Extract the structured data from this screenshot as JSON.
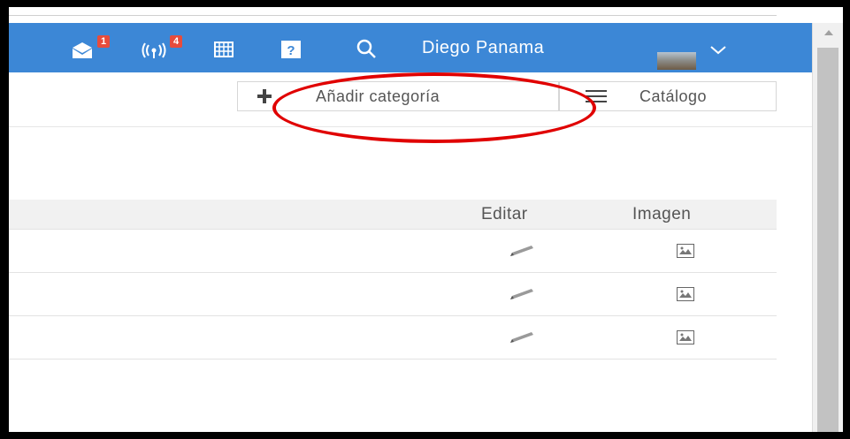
{
  "header": {
    "mail_badge": "1",
    "signal_badge": "4",
    "user_name": "Diego Panama",
    "icons": [
      "mail-icon",
      "signal-icon",
      "grid-icon",
      "help-icon",
      "search-icon",
      "chevron-down-icon"
    ],
    "bar_color": "#3c87d6",
    "badge_color": "#e74c3c"
  },
  "toolbar": {
    "add_category_label": "Añadir categoría",
    "catalog_label": "Catálogo"
  },
  "table": {
    "columns": [
      "Editar",
      "Imagen"
    ],
    "rows": [
      {
        "edit_icon": "pencil-icon",
        "image_icon": "image-icon"
      },
      {
        "edit_icon": "pencil-icon",
        "image_icon": "image-icon"
      },
      {
        "edit_icon": "pencil-icon",
        "image_icon": "image-icon"
      }
    ]
  },
  "annotation": {
    "color": "#e00000",
    "shape": "ellipse"
  }
}
